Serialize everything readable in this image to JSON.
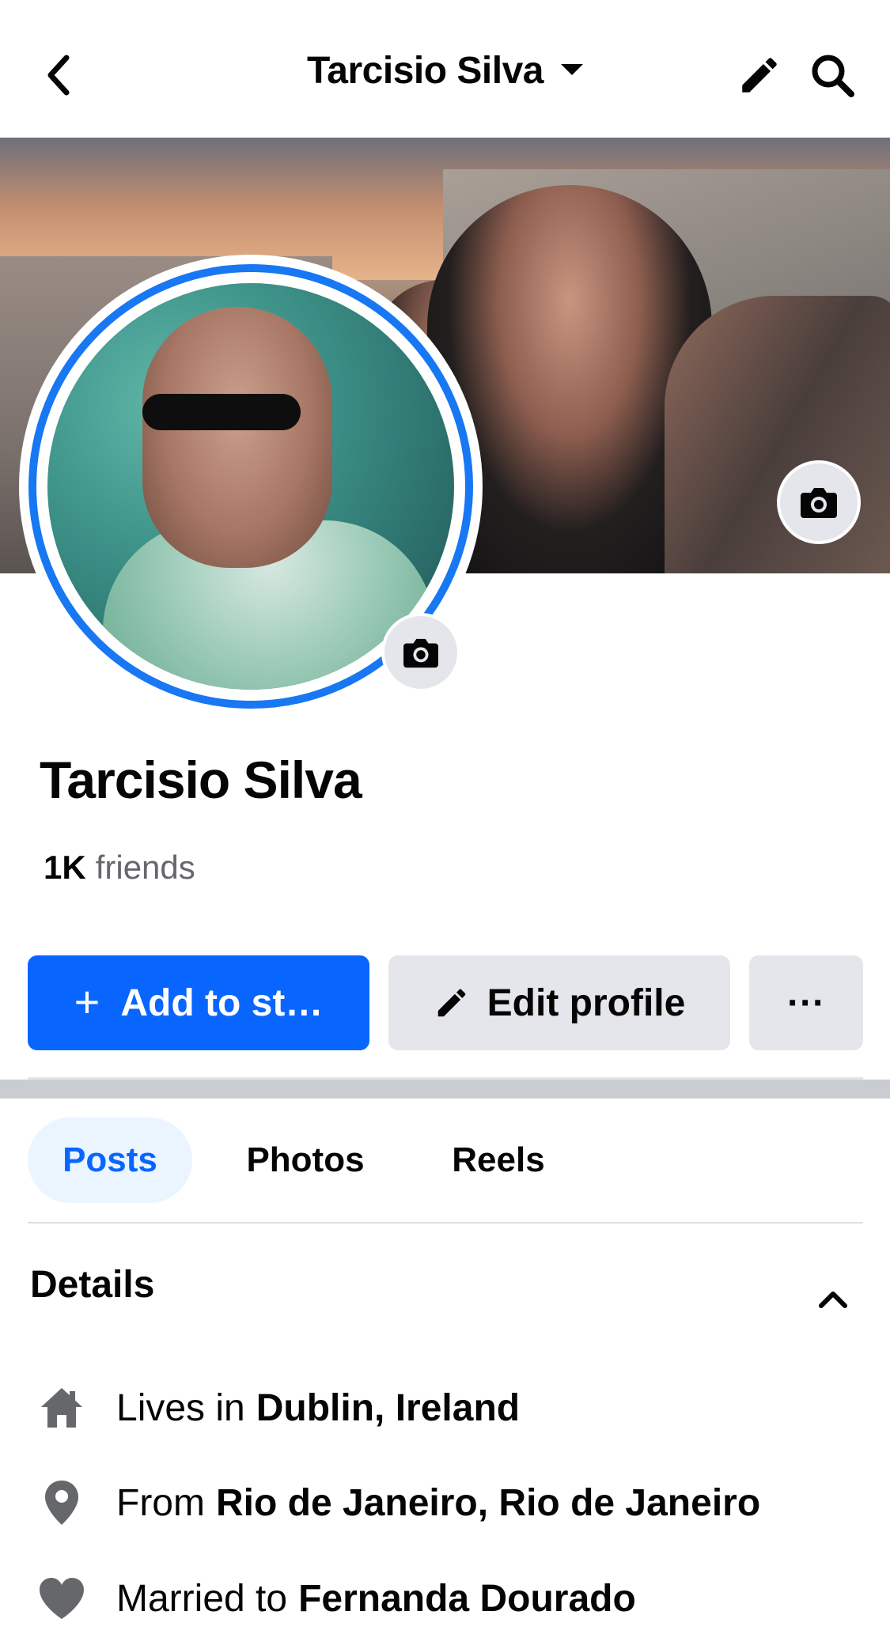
{
  "header": {
    "title": "Tarcisio Silva"
  },
  "profile": {
    "name": "Tarcisio Silva",
    "friends_count": "1K",
    "friends_label": "friends"
  },
  "actions": {
    "add_story_label": "Add to st…",
    "add_story_plus": "+",
    "edit_profile_label": "Edit profile",
    "more_label": "···"
  },
  "tabs": [
    {
      "label": "Posts",
      "selected": true
    },
    {
      "label": "Photos",
      "selected": false
    },
    {
      "label": "Reels",
      "selected": false
    }
  ],
  "details": {
    "title": "Details",
    "rows": [
      {
        "icon": "home-icon",
        "prefix": "Lives in",
        "value": "Dublin, Ireland"
      },
      {
        "icon": "location-pin-icon",
        "prefix": "From",
        "value": "Rio de Janeiro, Rio de Janeiro"
      },
      {
        "icon": "heart-icon",
        "prefix": "Married to",
        "value": "Fernanda Dourado"
      }
    ]
  },
  "colors": {
    "accent": "#0866ff",
    "ring": "#1877f2",
    "tab_selected_bg": "#ebf5ff",
    "button_gray": "#e4e6eb",
    "secondary_text": "#65676b"
  }
}
